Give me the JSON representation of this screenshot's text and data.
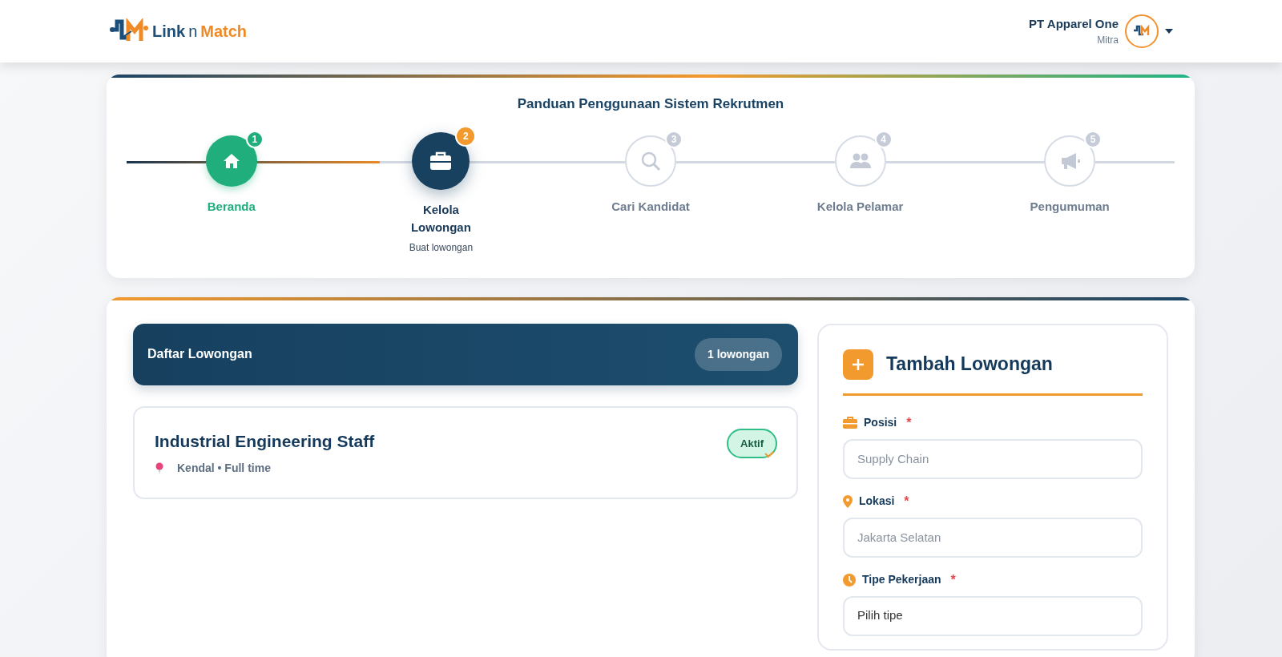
{
  "header": {
    "logo": {
      "part_1": "Link",
      "part_2": "n",
      "part_3": "Match"
    },
    "user": {
      "name": "PT Apparel One",
      "role": "Mitra"
    }
  },
  "guide": {
    "title": "Panduan Penggunaan Sistem Rekrutmen",
    "steps": [
      {
        "number": "1",
        "label": "Beranda",
        "kind": "done"
      },
      {
        "number": "2",
        "label": "Kelola Lowongan",
        "sublabel": "Buat lowongan",
        "kind": "current"
      },
      {
        "number": "3",
        "label": "Cari Kandidat",
        "kind": "upcoming"
      },
      {
        "number": "4",
        "label": "Kelola Pelamar",
        "kind": "upcoming"
      },
      {
        "number": "5",
        "label": "Pengumuman",
        "kind": "upcoming"
      }
    ]
  },
  "vacancy_list": {
    "title": "Daftar Lowongan",
    "count": "1 lowongan",
    "items": [
      {
        "title": "Industrial Engineering Staff",
        "meta": "Kendal • Full time",
        "status": "Aktif",
        "active": true
      }
    ]
  },
  "add_form": {
    "title": "Tambah Lowongan",
    "fields": [
      {
        "kind": "input",
        "label": "Posisi",
        "required_mark": "*",
        "placeholder": "Supply Chain"
      },
      {
        "kind": "input",
        "label": "Lokasi",
        "required_mark": "*",
        "placeholder": "Jakarta Selatan"
      },
      {
        "kind": "select",
        "label": "Tipe Pekerjaan",
        "required_mark": "*",
        "value": "Pilih tipe"
      }
    ]
  }
}
